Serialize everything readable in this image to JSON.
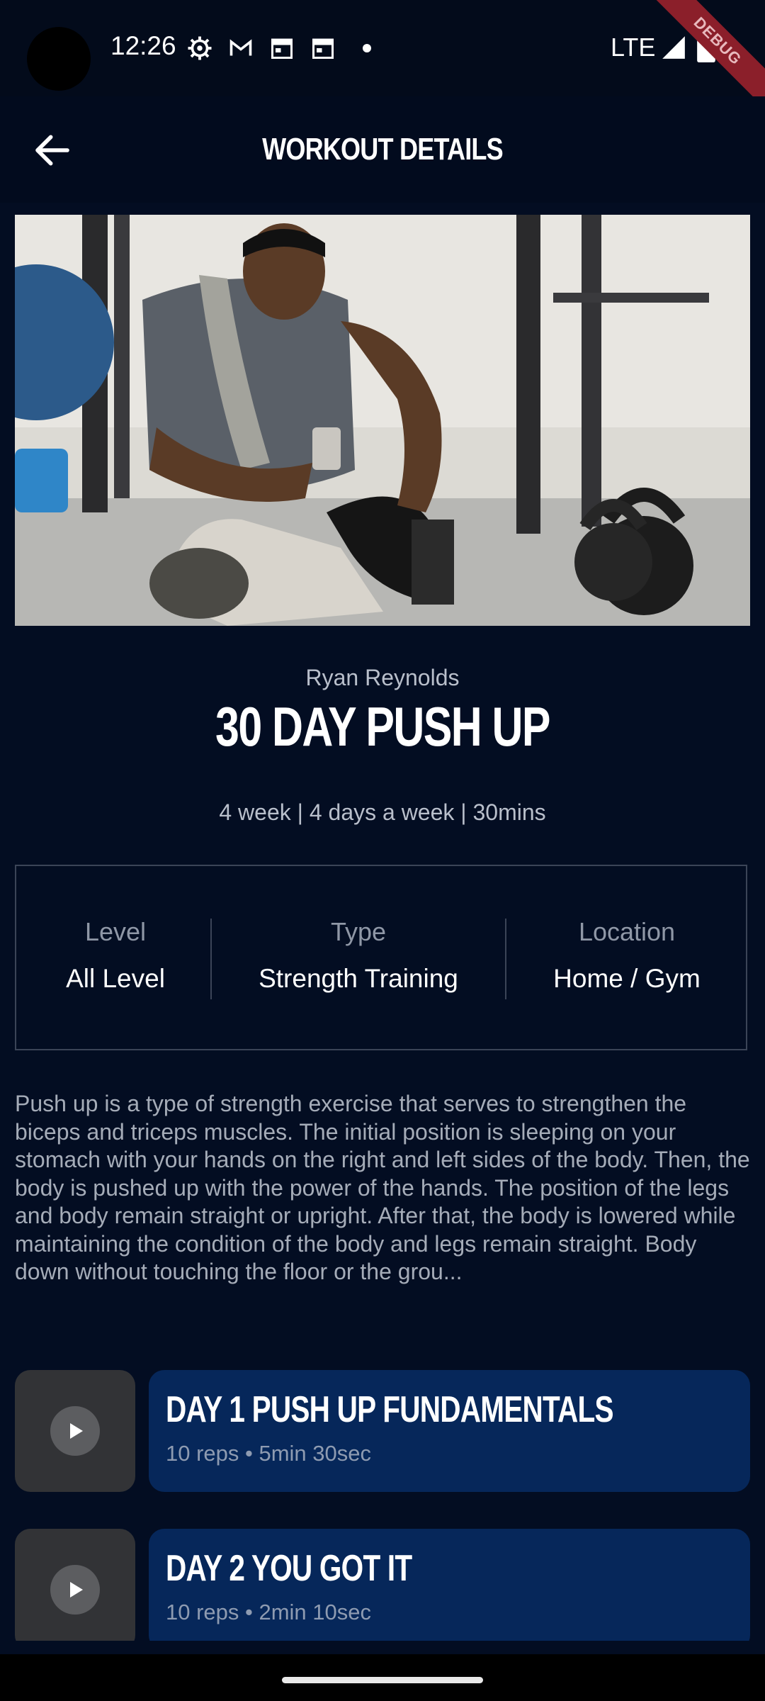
{
  "status_bar": {
    "time": "12:26",
    "network": "LTE",
    "debug_banner": "DEBUG",
    "icons": [
      "settings-icon",
      "gmail-icon",
      "calendar-icon",
      "calendar-icon",
      "dot-icon",
      "signal-icon",
      "battery-icon"
    ]
  },
  "app_bar": {
    "title": "WORKOUT DETAILS",
    "back_icon": "arrow-left-icon"
  },
  "workout": {
    "author": "Ryan Reynolds",
    "title": "30 DAY PUSH UP",
    "meta": "4 week | 4 days a week | 30mins",
    "info": [
      {
        "label": "Level",
        "value": "All Level"
      },
      {
        "label": "Type",
        "value": "Strength Training"
      },
      {
        "label": "Location",
        "value": "Home / Gym"
      }
    ],
    "description": "Push up is a type of strength exercise that serves to strengthen the biceps and triceps muscles. The initial position is sleeping on your stomach with your hands on the right and left sides of the body. Then, the body is pushed up with the power of the hands. The position of the legs and body remain straight or upright. After that, the body is lowered while maintaining the condition of the body and legs remain straight. Body down without touching the floor or the grou..."
  },
  "days": [
    {
      "title": "DAY 1 PUSH UP FUNDAMENTALS",
      "subtitle": "10 reps • 5min 30sec"
    },
    {
      "title": "DAY 2 YOU GOT IT",
      "subtitle": "10 reps • 2min 10sec"
    }
  ],
  "colors": {
    "background": "#030d22",
    "card": "#06275a",
    "thumbnail": "#323336",
    "muted_text": "#b9bfcb"
  }
}
